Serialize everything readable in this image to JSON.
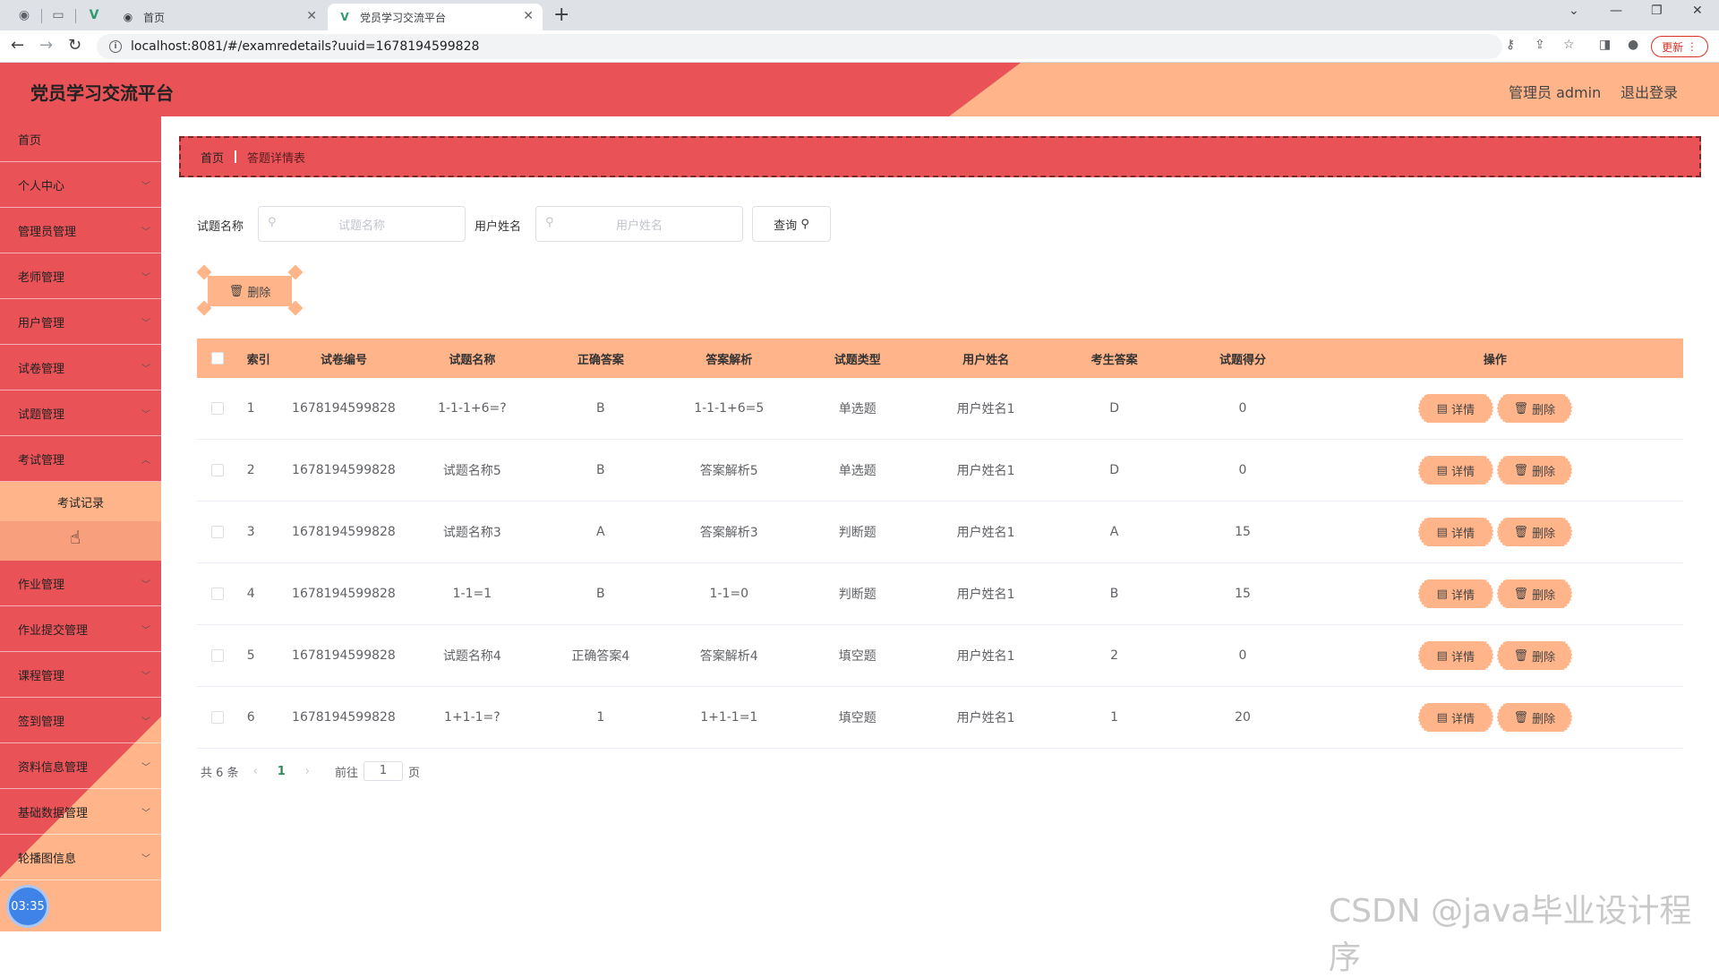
{
  "browser": {
    "tabs": [
      {
        "title": "首页",
        "active": false
      },
      {
        "title": "党员学习交流平台",
        "active": true
      }
    ],
    "url": "localhost:8081/#/examredetails?uuid=1678194599828",
    "update_label": "更新"
  },
  "header": {
    "title": "党员学习交流平台",
    "user": "管理员 admin",
    "logout": "退出登录",
    "accent_red": "#e95257",
    "accent_peach": "#ffb48a"
  },
  "sidebar": {
    "items": [
      {
        "label": "首页",
        "has_children": false
      },
      {
        "label": "个人中心",
        "has_children": true
      },
      {
        "label": "管理员管理",
        "has_children": true
      },
      {
        "label": "老师管理",
        "has_children": true
      },
      {
        "label": "用户管理",
        "has_children": true
      },
      {
        "label": "试卷管理",
        "has_children": true
      },
      {
        "label": "试题管理",
        "has_children": true
      },
      {
        "label": "考试管理",
        "has_children": true,
        "expanded": true
      },
      {
        "label": "作业管理",
        "has_children": true
      },
      {
        "label": "作业提交管理",
        "has_children": true
      },
      {
        "label": "课程管理",
        "has_children": true
      },
      {
        "label": "签到管理",
        "has_children": true
      },
      {
        "label": "资料信息管理",
        "has_children": true
      },
      {
        "label": "基础数据管理",
        "has_children": true
      },
      {
        "label": "轮播图信息",
        "has_children": true
      }
    ],
    "exam_submenu": [
      "考试记录"
    ],
    "clock": "03:35"
  },
  "breadcrumb": {
    "home": "首页",
    "current": "答题详情表"
  },
  "search": {
    "question_label": "试题名称",
    "question_placeholder": "试题名称",
    "user_label": "用户姓名",
    "user_placeholder": "用户姓名",
    "query_label": "查询"
  },
  "bulk_delete_label": "删除",
  "table": {
    "headers": [
      "索引",
      "试卷编号",
      "试题名称",
      "正确答案",
      "答案解析",
      "试题类型",
      "用户姓名",
      "考生答案",
      "试题得分",
      "操作"
    ],
    "rows": [
      {
        "idx": "1",
        "paper": "1678194599828",
        "question": "1-1-1+6=?",
        "correct": "B",
        "analysis": "1-1-1+6=5",
        "type": "单选题",
        "user": "用户姓名1",
        "answer": "D",
        "score": "0"
      },
      {
        "idx": "2",
        "paper": "1678194599828",
        "question": "试题名称5",
        "correct": "B",
        "analysis": "答案解析5",
        "type": "单选题",
        "user": "用户姓名1",
        "answer": "D",
        "score": "0"
      },
      {
        "idx": "3",
        "paper": "1678194599828",
        "question": "试题名称3",
        "correct": "A",
        "analysis": "答案解析3",
        "type": "判断题",
        "user": "用户姓名1",
        "answer": "A",
        "score": "15"
      },
      {
        "idx": "4",
        "paper": "1678194599828",
        "question": "1-1=1",
        "correct": "B",
        "analysis": "1-1=0",
        "type": "判断题",
        "user": "用户姓名1",
        "answer": "B",
        "score": "15"
      },
      {
        "idx": "5",
        "paper": "1678194599828",
        "question": "试题名称4",
        "correct": "正确答案4",
        "analysis": "答案解析4",
        "type": "填空题",
        "user": "用户姓名1",
        "answer": "2",
        "score": "0"
      },
      {
        "idx": "6",
        "paper": "1678194599828",
        "question": "1+1-1=?",
        "correct": "1",
        "analysis": "1+1-1=1",
        "type": "填空题",
        "user": "用户姓名1",
        "answer": "1",
        "score": "20"
      }
    ],
    "detail_label": "详情",
    "delete_label": "删除"
  },
  "pagination": {
    "total": "共 6 条",
    "current_page": "1",
    "goto_label": "前往",
    "goto_value": "1",
    "page_unit": "页"
  },
  "watermark": "CSDN @java毕业设计程序"
}
